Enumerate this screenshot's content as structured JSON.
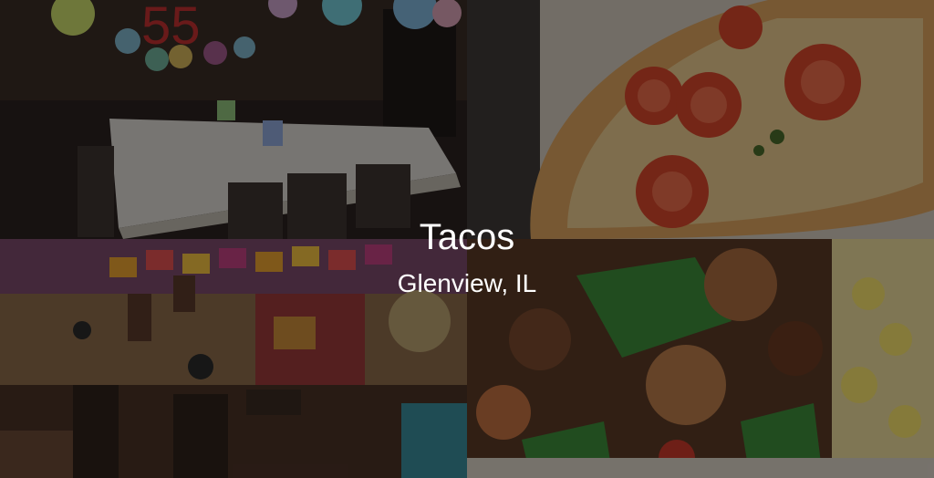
{
  "banner": {
    "title": "Tacos",
    "subtitle": "Glenview, IL"
  },
  "photos": {
    "party_room_number": "55"
  }
}
